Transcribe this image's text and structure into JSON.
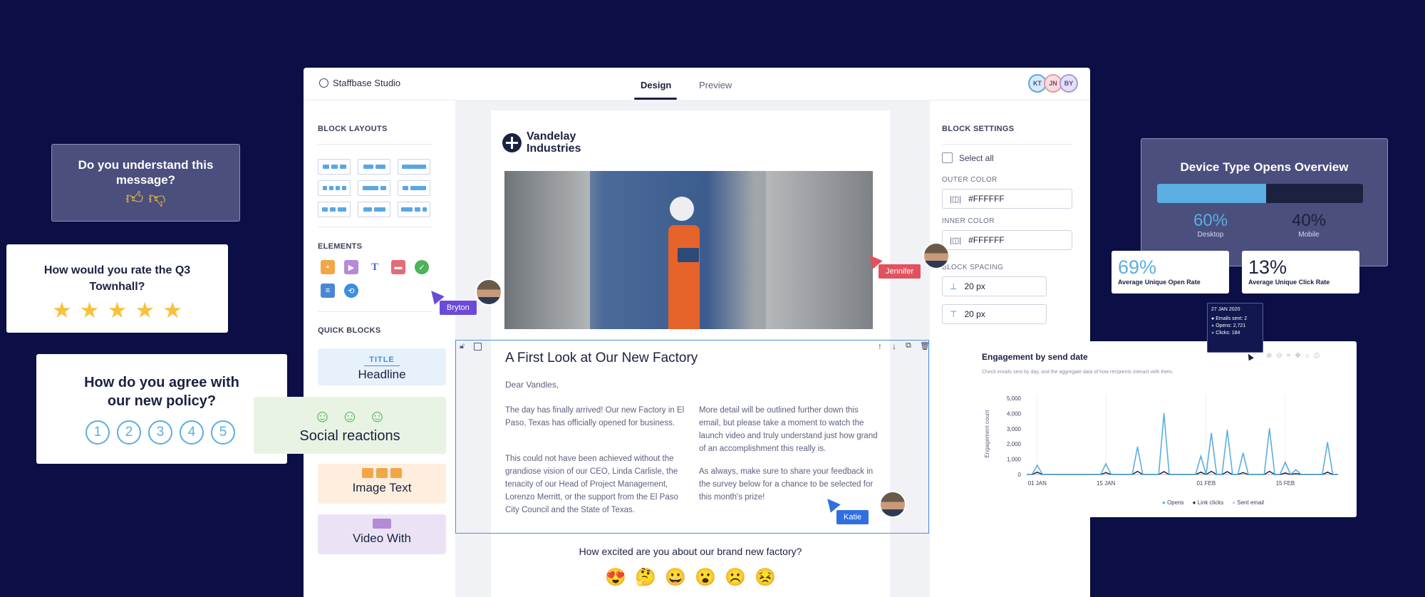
{
  "app": {
    "title": "Staffbase Studio",
    "tabs": [
      "Design",
      "Preview"
    ],
    "avatars": [
      "KT",
      "JN",
      "BY"
    ]
  },
  "left_panel": {
    "block_layouts_title": "BLOCK LAYOUTS",
    "elements_title": "ELEMENTS",
    "elements_icons": [
      "image-icon",
      "video-icon",
      "text-icon",
      "shape-icon",
      "check-icon",
      "divider-icon",
      "share-icon"
    ],
    "quick_blocks_title": "QUICK BLOCKS",
    "quick_blocks": {
      "headline_tag": "TITLE",
      "headline": "Headline",
      "social": "Social reactions",
      "image_text": "Image Text",
      "video": "Video With"
    }
  },
  "email": {
    "logo_line1": "Vandelay",
    "logo_line2": "Industries",
    "headline": "A First Look at Our New Factory",
    "greeting": "Dear Vandles,",
    "col1_p1": "The day has finally arrived! Our new Factory in El Paso, Texas has officially opened for business.",
    "col1_p2": "This could not have been achieved without the grandiose vision of our CEO, Linda Carlisle, the tenacity of our Head of Project Management, Lorenzo Merritt, or the support from the El Paso City Council and the State of Texas.",
    "col2_p1": "More detail will be outlined further down this email, but please take a moment to watch the launch video and truly understand just how grand of an accomplishment this really is.",
    "col2_p2": "As always, make sure to share your feedback in the survey below for a chance to be selected for this month's prize!",
    "survey_question": "How excited are you about our brand new factory?",
    "survey_emojis": [
      "😍",
      "🤔",
      "😀",
      "😮",
      "☹️",
      "😣"
    ]
  },
  "right_panel": {
    "title": "BLOCK SETTINGS",
    "select_all": "Select all",
    "outer_color_label": "OUTER COLOR",
    "outer_color": "#FFFFFF",
    "inner_color_label": "INNER COLOR",
    "inner_color": "#FFFFFF",
    "spacing_label": "BLOCK SPACING",
    "spacing_top": "20 px",
    "spacing_bottom": "20 px"
  },
  "collaborators": {
    "bryton": "Bryton",
    "jennifer": "Jennifer",
    "katie": "Katie"
  },
  "left_cards": {
    "understand_q": "Do you understand this message?",
    "rate_q": "How would you rate the Q3 Townhall?",
    "rate_stars": 5,
    "agree_q": "How do you agree with our new policy?",
    "agree_scale": [
      "1",
      "2",
      "3",
      "4",
      "5"
    ]
  },
  "device_card": {
    "title": "Device Type Opens Overview",
    "desktop_pct": "60%",
    "desktop_label": "Desktop",
    "mobile_pct": "40%",
    "mobile_label": "Mobile",
    "desktop_fraction": 0.53
  },
  "stat_cards": {
    "open_rate": "69%",
    "open_rate_label": "Average Unique Open Rate",
    "click_rate": "13%",
    "click_rate_label": "Average Unique Click Rate"
  },
  "tooltip": {
    "date": "27 JAN 2020",
    "sent": "Emails sent: 2",
    "opens": "Opens: 2,721",
    "clicks": "Clicks: 184"
  },
  "colors": {
    "bg": "#0b0f45",
    "opens": "#5aaee0",
    "clicks": "#1c2140",
    "sent": "#c8ccd6",
    "accent": "#3b6fd6"
  },
  "chart_data": {
    "type": "line",
    "title": "Engagement by send date",
    "subtitle": "Check emails sent by day, and the aggregate data of how recipients interact with them.",
    "ylabel": "Engagement count",
    "xlabel": "",
    "ylim": [
      0,
      5000
    ],
    "yticks": [
      "5,000",
      "4,000",
      "3,000",
      "2,000",
      "1,000",
      "0"
    ],
    "xticks": [
      "01 JAN",
      "15 JAN",
      "01 FEB",
      "15 FEB"
    ],
    "x": [
      1,
      2,
      3,
      4,
      5,
      6,
      7,
      8,
      9,
      10,
      11,
      12,
      13,
      14,
      15,
      16,
      17,
      18,
      19,
      20,
      21,
      22,
      23,
      24,
      25,
      26,
      27,
      28,
      29,
      30,
      31,
      32,
      33,
      34,
      35,
      36,
      37,
      38,
      39,
      40,
      41,
      42,
      43,
      44,
      45,
      46,
      47,
      48,
      49,
      50,
      51,
      52,
      53,
      54,
      55,
      56,
      57,
      58,
      59,
      60
    ],
    "series": [
      {
        "name": "Opens",
        "values": [
          0,
          0,
          600,
          0,
          0,
          0,
          0,
          0,
          0,
          0,
          0,
          0,
          0,
          0,
          0,
          700,
          0,
          0,
          0,
          0,
          0,
          1800,
          0,
          0,
          0,
          0,
          4000,
          0,
          0,
          0,
          0,
          0,
          0,
          1200,
          0,
          2700,
          0,
          0,
          2900,
          0,
          0,
          1400,
          0,
          0,
          0,
          0,
          3000,
          0,
          0,
          800,
          0,
          300,
          0,
          0,
          0,
          0,
          0,
          2100,
          0,
          0
        ]
      },
      {
        "name": "Link clicks",
        "values": [
          0,
          0,
          150,
          0,
          0,
          0,
          0,
          0,
          0,
          0,
          0,
          0,
          0,
          0,
          0,
          120,
          0,
          0,
          0,
          0,
          0,
          200,
          0,
          0,
          0,
          0,
          184,
          0,
          0,
          0,
          0,
          0,
          0,
          150,
          0,
          200,
          0,
          0,
          180,
          0,
          0,
          120,
          0,
          0,
          0,
          0,
          200,
          0,
          0,
          100,
          0,
          60,
          0,
          0,
          0,
          0,
          0,
          150,
          0,
          0
        ]
      },
      {
        "name": "Sent email",
        "values": [
          0,
          0,
          1,
          0,
          0,
          0,
          0,
          0,
          0,
          0,
          0,
          0,
          0,
          0,
          0,
          1,
          0,
          0,
          0,
          0,
          0,
          1,
          0,
          0,
          0,
          0,
          2,
          0,
          0,
          0,
          0,
          0,
          0,
          1,
          0,
          1,
          0,
          0,
          1,
          0,
          0,
          1,
          0,
          0,
          0,
          0,
          1,
          0,
          0,
          1,
          0,
          1,
          0,
          0,
          0,
          0,
          0,
          1,
          0,
          0
        ]
      }
    ],
    "legend": [
      "Opens",
      "Link clicks",
      "Sent email"
    ],
    "legend_position": "bottom",
    "grid": true
  }
}
